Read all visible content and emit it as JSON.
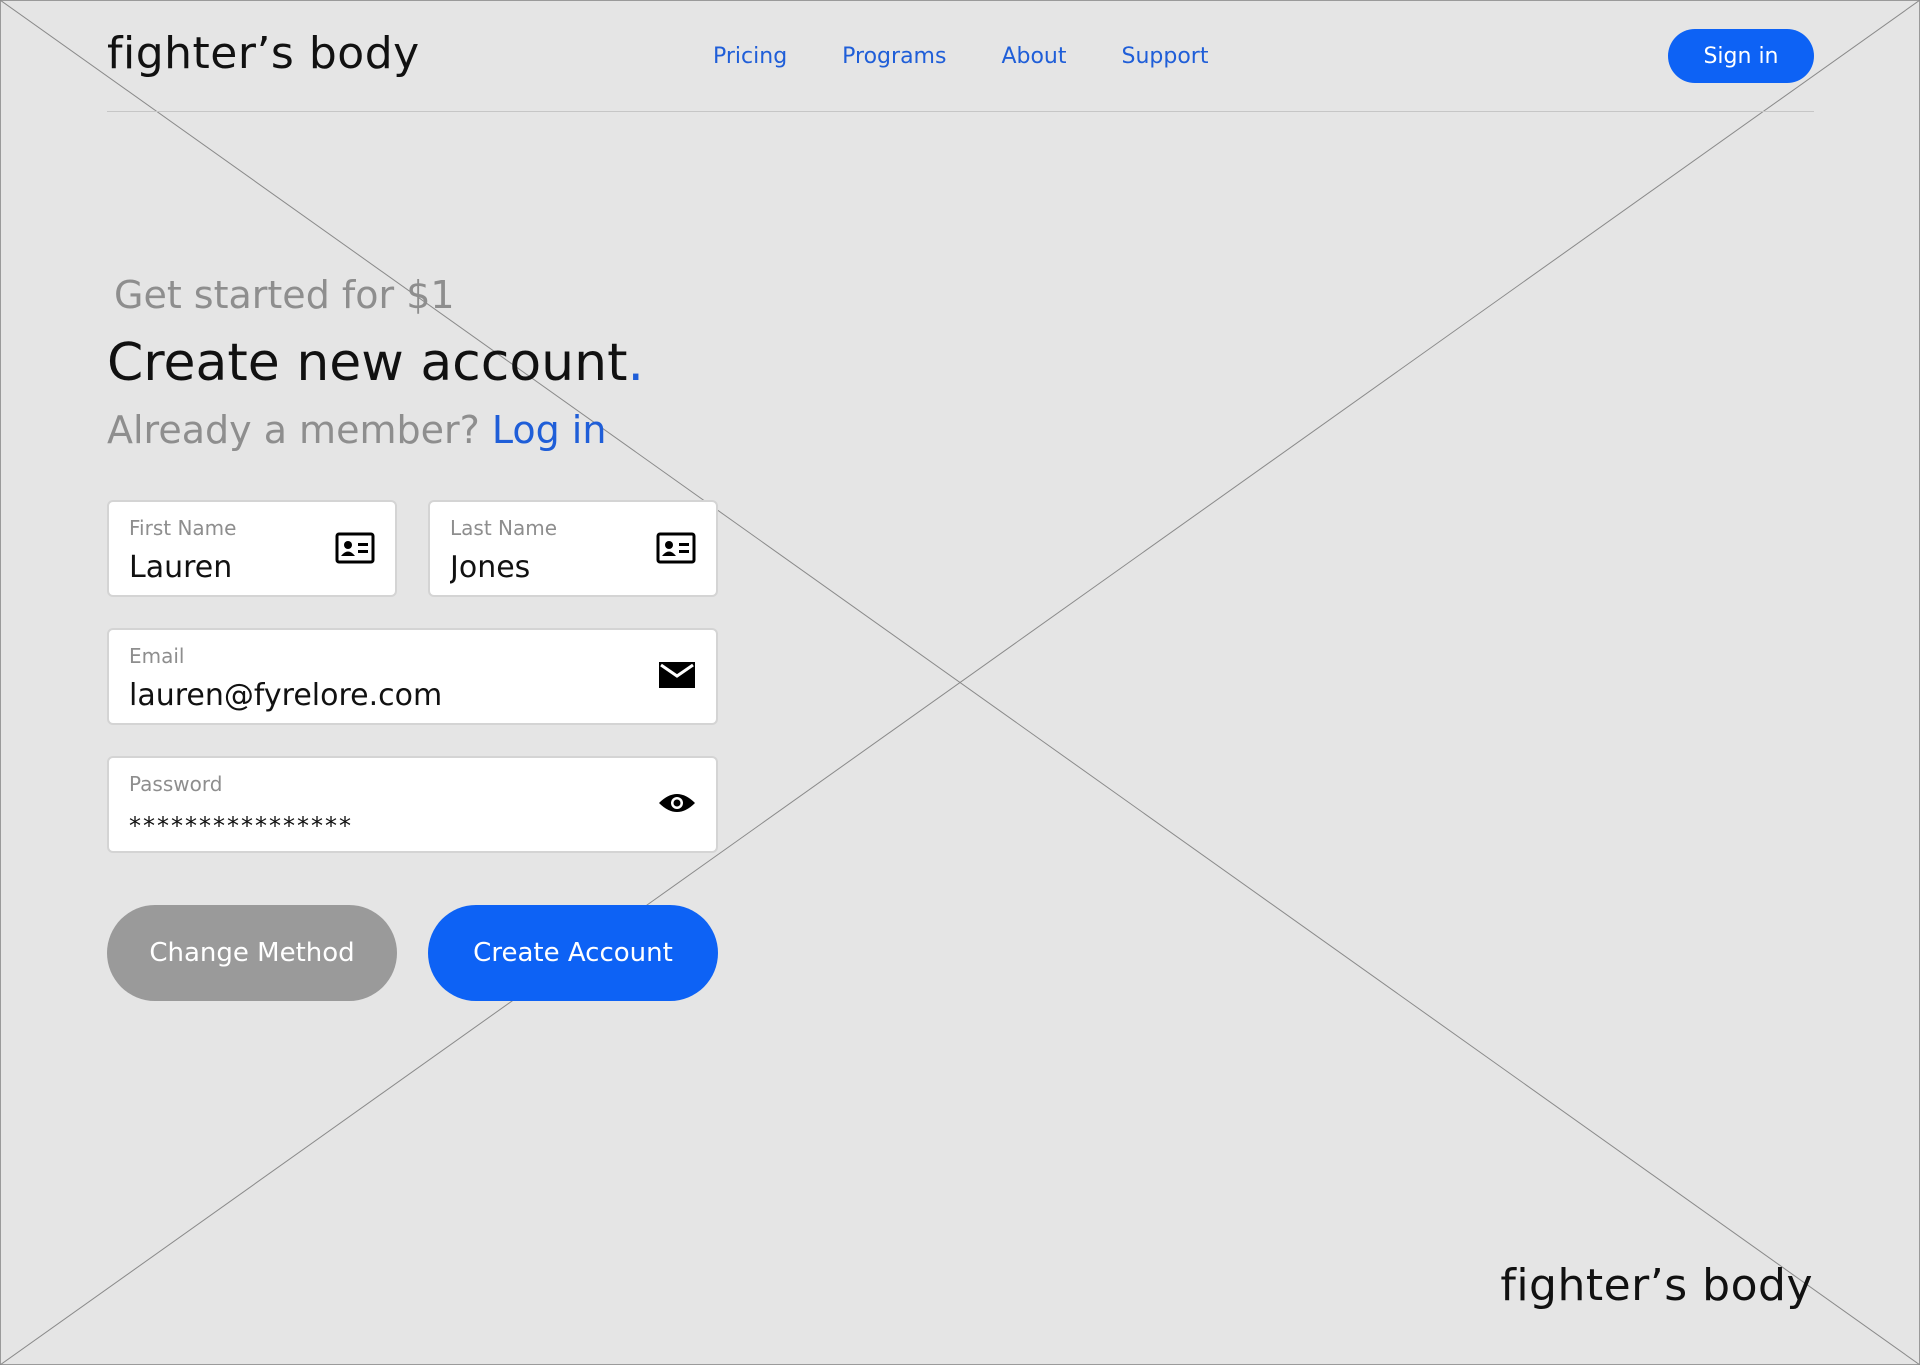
{
  "header": {
    "brand": "fighter’s body",
    "nav": [
      "Pricing",
      "Programs",
      "About",
      "Support"
    ],
    "signin_label": "Sign in"
  },
  "hero": {
    "eyebrow": "Get started for $1",
    "title": "Create new account",
    "title_dot": ".",
    "member_text": "Already a member?",
    "login_link": "Log in"
  },
  "form": {
    "first_name": {
      "label": "First Name",
      "value": "Lauren",
      "icon": "id-card-icon"
    },
    "last_name": {
      "label": "Last Name",
      "value": "Jones",
      "icon": "id-card-icon"
    },
    "email": {
      "label": "Email",
      "value": "lauren@fyrelore.com",
      "icon": "mail-icon"
    },
    "password": {
      "label": "Password",
      "value": "****************",
      "icon": "eye-icon"
    }
  },
  "actions": {
    "change_method": "Change Method",
    "create_account": "Create Account"
  },
  "footer": {
    "brand": "fighter’s body"
  },
  "colors": {
    "accent": "#0d62f5",
    "link": "#1f5ed8",
    "muted": "#8e8e8e",
    "background": "#e5e5e5",
    "secondary_button": "#9a9a9a"
  }
}
